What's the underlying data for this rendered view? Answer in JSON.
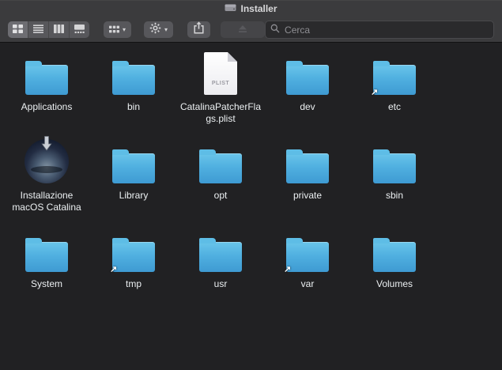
{
  "window": {
    "title": "Installer"
  },
  "toolbar": {
    "view_segments": [
      {
        "name": "icon-view",
        "selected": true
      },
      {
        "name": "list-view",
        "selected": false
      },
      {
        "name": "column-view",
        "selected": false
      },
      {
        "name": "gallery-view",
        "selected": false
      }
    ],
    "search": {
      "placeholder": "Cerca"
    }
  },
  "icons": {
    "chevron_down": "▾",
    "alias_arrow": "↗"
  },
  "items": [
    {
      "label": "Applications",
      "type": "folder"
    },
    {
      "label": "bin",
      "type": "folder"
    },
    {
      "label": "CatalinaPatcherFlags.plist",
      "type": "plist-document",
      "kind_badge": "PLIST"
    },
    {
      "label": "dev",
      "type": "folder"
    },
    {
      "label": "etc",
      "type": "folder",
      "alias": true
    },
    {
      "label": "Installazione macOS Catalina",
      "type": "installer-app"
    },
    {
      "label": "Library",
      "type": "folder"
    },
    {
      "label": "opt",
      "type": "folder"
    },
    {
      "label": "private",
      "type": "folder"
    },
    {
      "label": "sbin",
      "type": "folder"
    },
    {
      "label": "System",
      "type": "folder"
    },
    {
      "label": "tmp",
      "type": "folder",
      "alias": true
    },
    {
      "label": "usr",
      "type": "folder"
    },
    {
      "label": "var",
      "type": "folder",
      "alias": true
    },
    {
      "label": "Volumes",
      "type": "folder"
    }
  ],
  "colors": {
    "titlebar": "#3b3b3d",
    "content_background": "#212123",
    "folder_blue_top": "#6ac5ea",
    "folder_blue_bottom": "#3e9ad2",
    "label_text": "#ecf0f2",
    "placeholder_text": "#8e8e93"
  }
}
